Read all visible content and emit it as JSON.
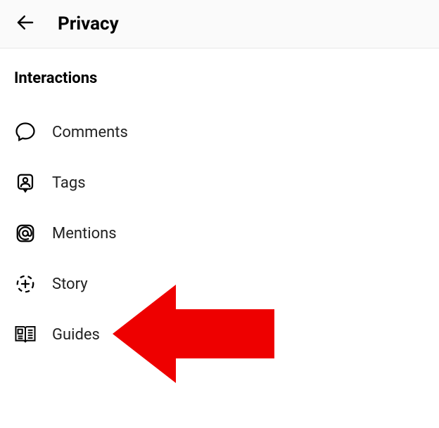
{
  "header": {
    "title": "Privacy"
  },
  "section": {
    "title": "Interactions"
  },
  "menu": {
    "items": [
      {
        "label": "Comments"
      },
      {
        "label": "Tags"
      },
      {
        "label": "Mentions"
      },
      {
        "label": "Story"
      },
      {
        "label": "Guides"
      }
    ]
  }
}
